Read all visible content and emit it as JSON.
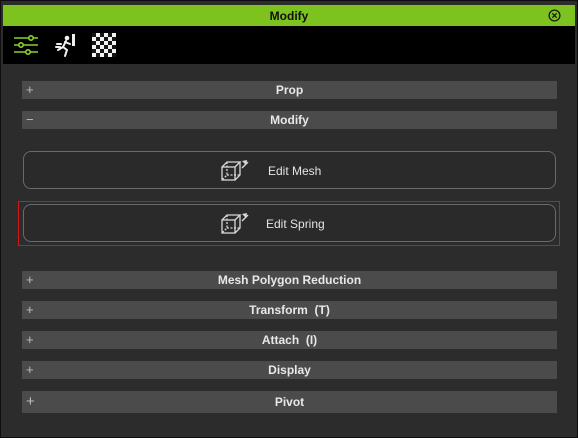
{
  "window": {
    "title": "Modify"
  },
  "toolbar": {
    "tools": [
      "modify-tool-icon",
      "motion-tool-icon",
      "material-tool-icon"
    ]
  },
  "sections": {
    "prop": {
      "sign": "+",
      "label": "Prop"
    },
    "modify": {
      "sign": "−",
      "label": "Modify"
    },
    "mesh_poly": {
      "sign": "+",
      "label": "Mesh Polygon Reduction"
    },
    "transform": {
      "sign": "+",
      "label": "Transform  (T)"
    },
    "attach": {
      "sign": "+",
      "label": "Attach  (I)"
    },
    "display": {
      "sign": "+",
      "label": "Display"
    },
    "pivot": {
      "sign": "+",
      "label": "Pivot"
    }
  },
  "buttons": {
    "edit_mesh": "Edit Mesh",
    "edit_spring": "Edit Spring"
  },
  "colors": {
    "accent": "#7dc21e",
    "highlight": "#d01818",
    "panel": "#2c2c2c",
    "section": "#4b4b4b"
  }
}
